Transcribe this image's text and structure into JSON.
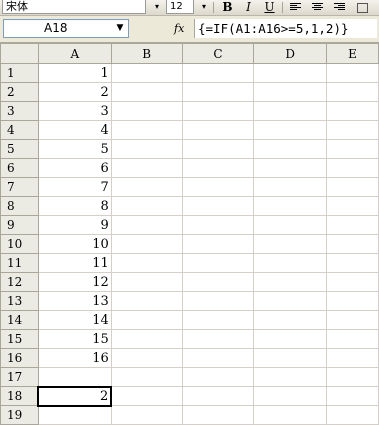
{
  "toolbar": {
    "font_name": "宋体",
    "font_size": "12",
    "bold": "B",
    "italic": "I",
    "underline": "U",
    "dropdown_glyph": "▾",
    "icons": [
      "align-left-icon",
      "align-center-icon",
      "align-right-icon",
      "merge-center-icon"
    ]
  },
  "formula_bar": {
    "name_box": "A18",
    "fx": "fx",
    "formula": "{=IF(A1:A16>=5,1,2)}"
  },
  "sheet": {
    "columns": [
      "A",
      "B",
      "C",
      "D",
      "E"
    ],
    "rows": [
      {
        "header": "1",
        "a": "1"
      },
      {
        "header": "2",
        "a": "2"
      },
      {
        "header": "3",
        "a": "3"
      },
      {
        "header": "4",
        "a": "4"
      },
      {
        "header": "5",
        "a": "5"
      },
      {
        "header": "6",
        "a": "6"
      },
      {
        "header": "7",
        "a": "7"
      },
      {
        "header": "8",
        "a": "8"
      },
      {
        "header": "9",
        "a": "9"
      },
      {
        "header": "10",
        "a": "10"
      },
      {
        "header": "11",
        "a": "11"
      },
      {
        "header": "12",
        "a": "12"
      },
      {
        "header": "13",
        "a": "13"
      },
      {
        "header": "14",
        "a": "14"
      },
      {
        "header": "15",
        "a": "15"
      },
      {
        "header": "16",
        "a": "16"
      },
      {
        "header": "17",
        "a": ""
      },
      {
        "header": "18",
        "a": "2"
      },
      {
        "header": "19",
        "a": ""
      }
    ],
    "selected_cell": "A18",
    "grid_color": "#d4d0c8",
    "header_color": "#ecebe3"
  }
}
